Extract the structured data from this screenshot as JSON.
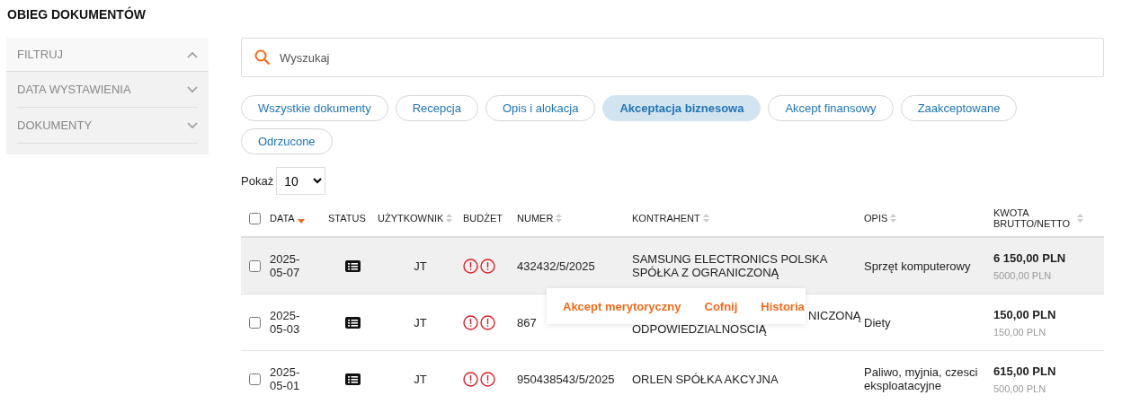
{
  "title": "OBIEG DOKUMENTÓW",
  "filters": [
    {
      "label": "FILTRUJ",
      "expanded": true
    },
    {
      "label": "DATA WYSTAWIENIA",
      "expanded": false
    },
    {
      "label": "DOKUMENTY",
      "expanded": false
    }
  ],
  "search": {
    "placeholder": "Wyszukaj"
  },
  "tabs": [
    {
      "label": "Wszystkie dokumenty",
      "selected": false
    },
    {
      "label": "Recepcja",
      "selected": false
    },
    {
      "label": "Opis i alokacja",
      "selected": false
    },
    {
      "label": "Akceptacja biznesowa",
      "selected": true
    },
    {
      "label": "Akcept finansowy",
      "selected": false
    },
    {
      "label": "Zaakceptowane",
      "selected": false
    },
    {
      "label": "Odrzucone",
      "selected": false
    }
  ],
  "page_size": {
    "label": "Pokaż",
    "value": "10"
  },
  "table": {
    "select_all": {
      "checked": false
    },
    "columns": [
      {
        "label": "DATA",
        "kind": "sortable",
        "sorted": true
      },
      {
        "label": "STATUS",
        "kind": "plain"
      },
      {
        "label": "UŻYTKOWNIK",
        "kind": "sortable",
        "sorted": false
      },
      {
        "label": "BUDŻET",
        "kind": "plain"
      },
      {
        "label": "NUMER",
        "kind": "sortable",
        "sorted": false
      },
      {
        "label": "KONTRAHENT",
        "kind": "sortable",
        "sorted": false
      },
      {
        "label": "OPIS",
        "kind": "sortable",
        "sorted": false
      },
      {
        "label": "KWOTA BRUTTO/NETTO",
        "kind": "sortable",
        "sorted": false
      }
    ],
    "rows": [
      {
        "checked": false,
        "hovered": true,
        "date": "2025-05-07",
        "user": "JT",
        "number": "432432/5/2025",
        "contractor": [
          "SAMSUNG ELECTRONICS POLSKA",
          "SPÓŁKA Z OGRANICZONĄ"
        ],
        "description": "Sprzęt komputerowy",
        "gross": "6 150,00 PLN",
        "net": "5000,00 PLN"
      },
      {
        "checked": false,
        "hovered": false,
        "date": "2025-05-03",
        "user": "JT",
        "number": "867",
        "contractor": [
          "NICZONĄ",
          "ODPOWIEDZIALNOSCIĄ"
        ],
        "contractor_cut": true,
        "description": "Diety",
        "gross": "150,00 PLN",
        "net": "150,00 PLN"
      },
      {
        "checked": false,
        "hovered": false,
        "date": "2025-05-01",
        "user": "JT",
        "number": "950438543/5/2025",
        "contractor": [
          "ORLEN SPÓŁKA AKCYJNA"
        ],
        "description": "Paliwo, myjnia, czesci eksploatacyjne",
        "gross": "615,00 PLN",
        "net": "500,00 PLN"
      }
    ]
  },
  "row_menu": [
    "Akcept merytoryczny",
    "Cofnij",
    "Historia"
  ]
}
